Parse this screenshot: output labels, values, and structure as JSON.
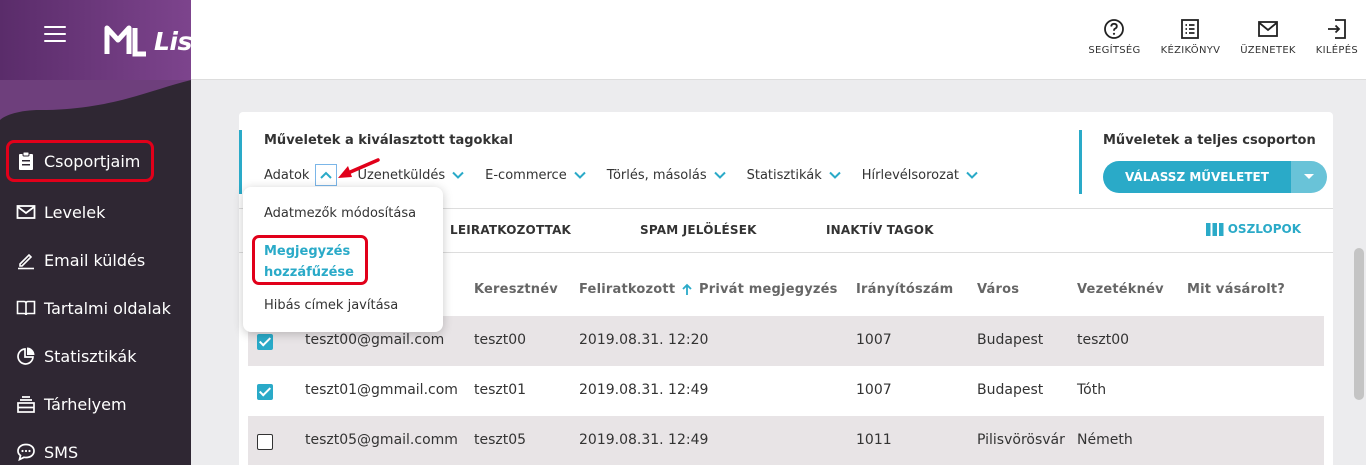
{
  "app": {
    "logo_text": "ListaMester"
  },
  "sidebar": {
    "items": [
      {
        "label": "Csoportjaim",
        "icon": "clipboard-icon"
      },
      {
        "label": "Levelek",
        "icon": "envelope-icon"
      },
      {
        "label": "Email küldés",
        "icon": "pencil-icon"
      },
      {
        "label": "Tartalmi oldalak",
        "icon": "book-icon"
      },
      {
        "label": "Statisztikák",
        "icon": "pie-chart-icon"
      },
      {
        "label": "Tárhelyem",
        "icon": "storage-icon"
      },
      {
        "label": "SMS",
        "icon": "chat-icon"
      }
    ]
  },
  "topbar": {
    "help": "SEGÍTSÉG",
    "manual": "KÉZIKÖNYV",
    "messages": "ÜZENETEK",
    "logout": "KILÉPÉS"
  },
  "ops_selected": {
    "title": "Műveletek a kiválasztott tagokkal",
    "menu": [
      "Adatok",
      "Üzenetküldés",
      "E-commerce",
      "Törlés, másolás",
      "Statisztikák",
      "Hírlevélsorozat"
    ]
  },
  "ops_group": {
    "title": "Műveletek a teljes csoporton",
    "button": "VÁLASSZ MŰVELETET"
  },
  "dropdown": {
    "items": [
      "Adatmezők módosítása",
      "Megjegyzés",
      "hozzáfűzése",
      "Hibás címek javítása"
    ]
  },
  "tabs": [
    "LEIRATKOZOTTAK",
    "SPAM JELÖLÉSEK",
    "INAKTÍV TAGOK"
  ],
  "columns_button": "OSZLOPOK",
  "table": {
    "headers": [
      "Keresztnév",
      "Feliratkozott",
      "Privát megjegyzés",
      "Irányítószám",
      "Város",
      "Vezetéknév",
      "Mit vásárolt?"
    ],
    "rows": [
      {
        "checked": true,
        "email": "teszt00@gmail.com",
        "first": "teszt00",
        "date": "2019.08.31. 12:20",
        "note": "",
        "zip": "1007",
        "city": "Budapest",
        "last": "teszt00",
        "bought": ""
      },
      {
        "checked": true,
        "email": "teszt01@gmmail.com",
        "first": "teszt01",
        "date": "2019.08.31. 12:49",
        "note": "",
        "zip": "1007",
        "city": "Budapest",
        "last": "Tóth",
        "bought": ""
      },
      {
        "checked": false,
        "email": "teszt05@gmail.comm",
        "first": "teszt05",
        "date": "2019.08.31. 12:49",
        "note": "",
        "zip": "1011",
        "city": "Pilisvörösvár",
        "last": "Németh",
        "bought": ""
      }
    ]
  },
  "colors": {
    "accent": "#2aaac8",
    "highlight": "#e1001a",
    "sidebar": "#2f2733",
    "brand_gradient_end": "#9b5fae"
  }
}
